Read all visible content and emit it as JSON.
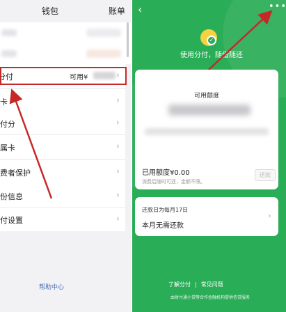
{
  "wallet": {
    "title": "钱包",
    "ledger": "账单",
    "menu": [
      {
        "label": "付分付",
        "available": "可用¥",
        "chev": "›"
      },
      {
        "label": "银行卡",
        "chev": "›"
      },
      {
        "label": "微信支付分",
        "chev": "›"
      },
      {
        "label": "亲属卡",
        "chev": "›"
      },
      {
        "label": "消费者保护",
        "chev": "›"
      },
      {
        "label": "身份信息",
        "chev": "›"
      },
      {
        "label": "支付设置",
        "chev": "›"
      }
    ],
    "help": "帮助中心"
  },
  "fenfu": {
    "back": "‹",
    "more": "•••",
    "logo_check": "✓",
    "slogan": "使用分付，随借随还",
    "credit_label": "可用额度",
    "used_label": "已用额度¥0.00",
    "hint": "消费后随时可还，金额不限。",
    "repay_button": "还款",
    "due_text": "还款日为每月17日",
    "no_due_text": "本月无需还款",
    "chev": "›",
    "links": [
      "了解分付",
      "常见问题"
    ],
    "link_sep": "|",
    "footer": "由财付通小贷等合作金融机构提供信贷服务"
  },
  "colors": {
    "brand_green": "#2aad57",
    "arrow_red": "#c62828"
  }
}
